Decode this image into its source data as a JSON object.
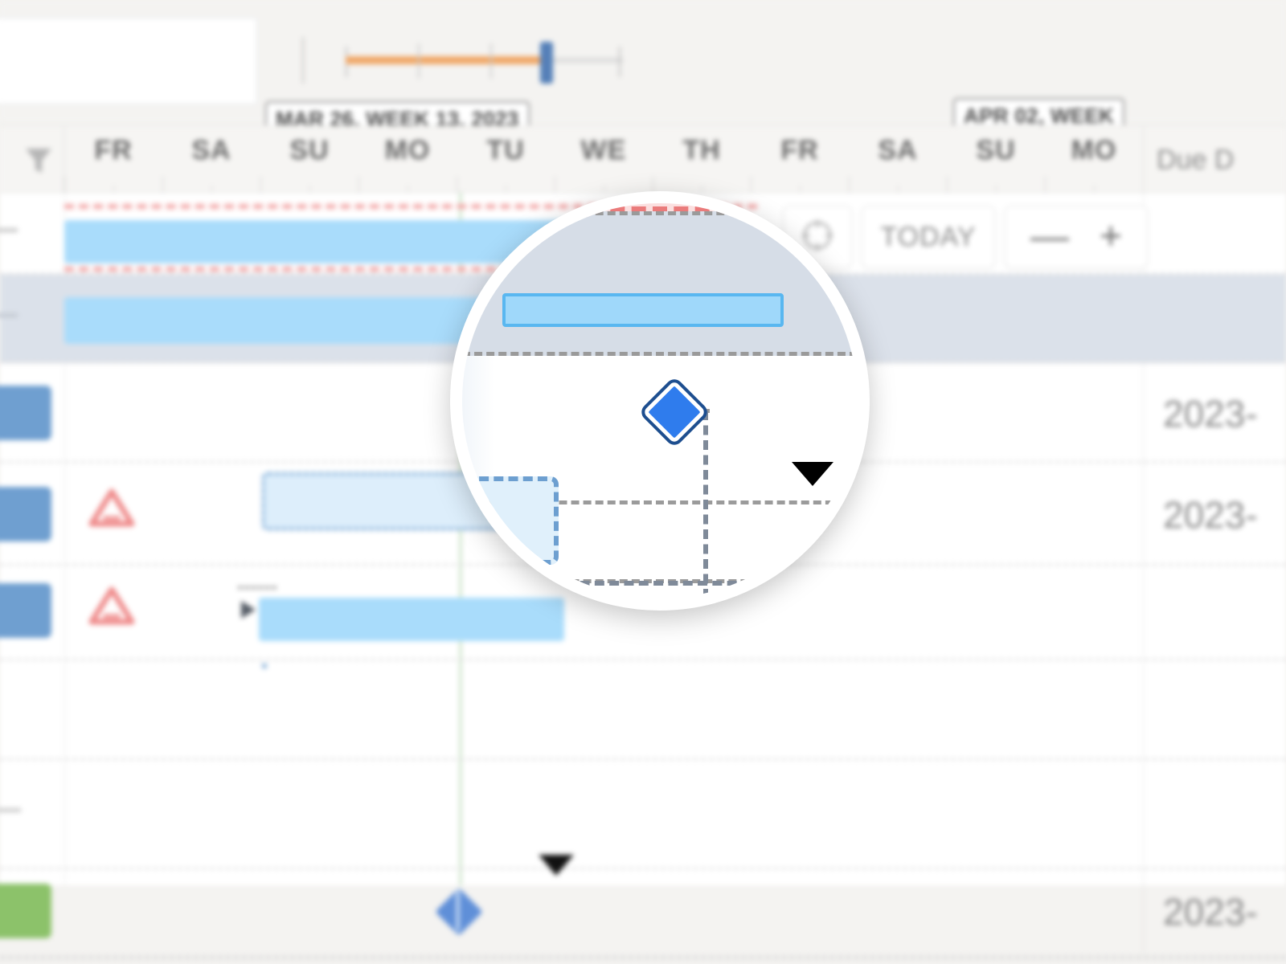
{
  "app": {
    "kind": "gantt-chart-timeline"
  },
  "search": {
    "value": "",
    "placeholder": ""
  },
  "overview": {
    "progress_color": "#f0a868",
    "handle_color": "#5580b8",
    "track_color": "#dcdcdc"
  },
  "callouts": [
    {
      "id": "mar",
      "label": "MAR 26, WEEK 13, 2023"
    },
    {
      "id": "apr",
      "label": "APR 02, WEEK"
    }
  ],
  "timeline": {
    "filter_icon": "filter-funnel-icon",
    "days": [
      "FR",
      "SA",
      "SU",
      "MO",
      "TU",
      "WE",
      "TH",
      "FR",
      "SA",
      "SU",
      "MO"
    ],
    "due_date_header": "Due D"
  },
  "toolbar": {
    "fit_icon": "fit-to-screen-icon",
    "today_label": "TODAY",
    "zoom_out_label": "—",
    "zoom_in_label": "+"
  },
  "rows": [
    {
      "name": "row-baseline-task",
      "swatch": "",
      "warning": "",
      "due_date": "",
      "bar_type": "light-with-baseline"
    },
    {
      "name": "row-selected-task",
      "swatch": "",
      "warning": "",
      "due_date": "",
      "bar_type": "light",
      "selected": true
    },
    {
      "name": "row-milestone-task",
      "swatch": "blue",
      "warning": "",
      "due_date": "2023-",
      "bar_type": "milestone"
    },
    {
      "name": "row-ghost-task",
      "swatch": "blue",
      "warning": "warning-triangle-icon",
      "due_date": "2023-",
      "bar_type": "ghost"
    },
    {
      "name": "row-dependent-task",
      "swatch": "blue",
      "warning": "warning-triangle-icon",
      "due_date": "",
      "bar_type": "bordered-with-arrow"
    },
    {
      "name": "row-empty-a",
      "swatch": "",
      "warning": "",
      "due_date": "",
      "bar_type": "none"
    },
    {
      "name": "row-empty-b",
      "swatch": "",
      "warning": "",
      "due_date": "",
      "bar_type": "none"
    },
    {
      "name": "row-green-milestone",
      "swatch": "green",
      "warning": "",
      "due_date": "2023-",
      "bar_type": "milestone-green-line"
    }
  ],
  "colors": {
    "bar_fill": "#9fd8fa",
    "bar_border": "#59b7f0",
    "bar_light": "#a9dcfb",
    "baseline_red": "#f3a9a9",
    "selected_row": "#dbe1ea",
    "today_line_green": "#a8cfa2",
    "milestone_blue": "#2f7ced",
    "swatch_blue": "#6f9fd0",
    "swatch_green": "#8cc26a",
    "warning_red": "#ef8b8b",
    "page_bg": "#f4f3f1"
  }
}
